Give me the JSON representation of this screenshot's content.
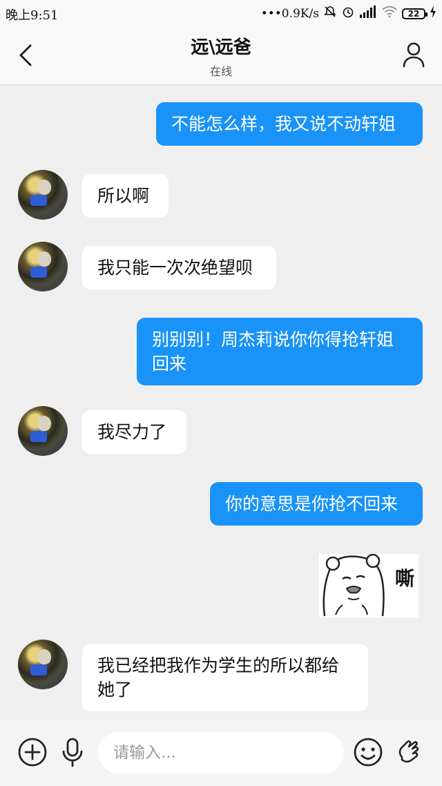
{
  "status_bar": {
    "time": "晚上9:51",
    "network_speed": "•••0.9K/s",
    "battery": "22"
  },
  "header": {
    "title": "远\\远爸",
    "subtitle": "在线"
  },
  "messages": [
    {
      "side": "out",
      "text": "不能怎么样，我又说不动轩姐"
    },
    {
      "side": "in",
      "text": "所以啊"
    },
    {
      "side": "in",
      "text": "我只能一次次绝望呗"
    },
    {
      "side": "out",
      "text": "别别别！周杰莉说你你得抢轩姐回来"
    },
    {
      "side": "in",
      "text": "我尽力了"
    },
    {
      "side": "out",
      "text": "你的意思是你抢不回来"
    },
    {
      "side": "out",
      "type": "sticker",
      "text": "嘶"
    },
    {
      "side": "in",
      "text": "我已经把我作为学生的所以都给她了"
    }
  ],
  "input": {
    "placeholder": "请输入..."
  },
  "colors": {
    "outgoing_bubble": "#1a93f8",
    "incoming_bubble": "#ffffff",
    "chat_background": "#efefef"
  }
}
